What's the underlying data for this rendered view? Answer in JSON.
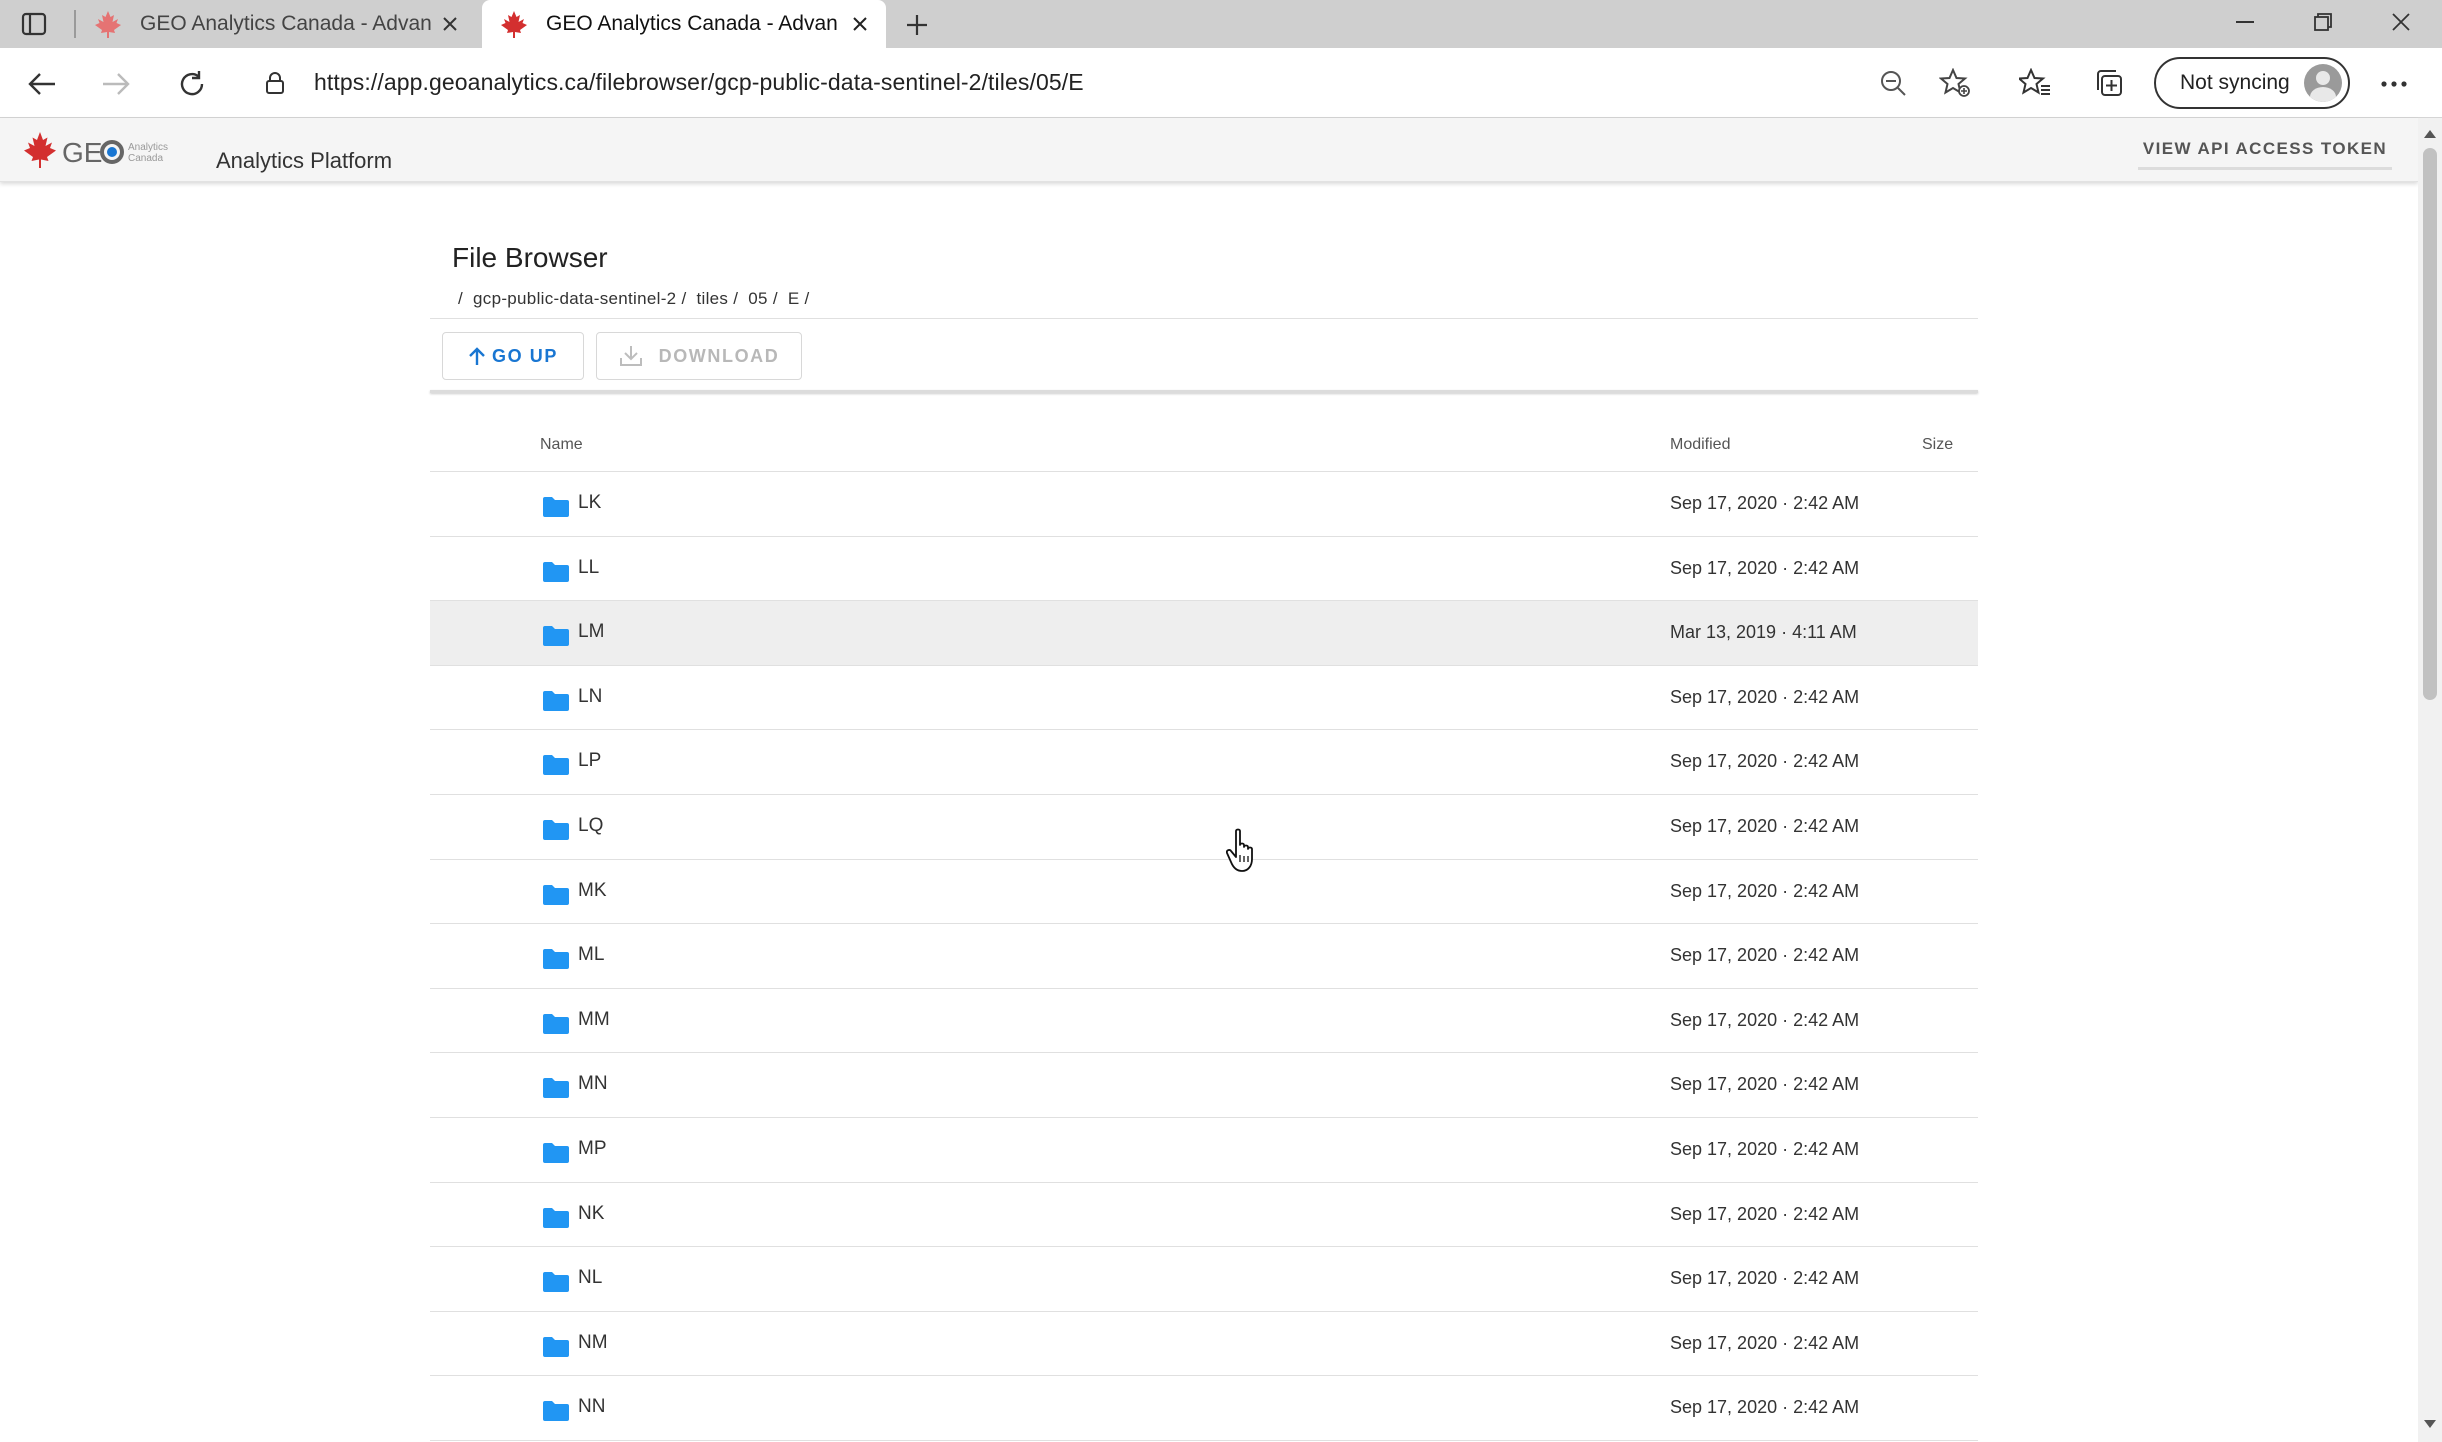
{
  "browser": {
    "tabs": [
      {
        "title": "GEO Analytics Canada - Advancing",
        "active": false
      },
      {
        "title": "GEO Analytics Canada - Advancing",
        "active": true
      }
    ],
    "url": "https://app.geoanalytics.ca/filebrowser/gcp-public-data-sentinel-2/tiles/05/E",
    "profile_label": "Not syncing",
    "icons": {
      "sidebar": "tab-actions-icon",
      "new_tab": "plus-icon",
      "back": "back-arrow-icon",
      "forward": "forward-arrow-icon",
      "refresh": "refresh-icon",
      "lock": "lock-icon",
      "zoom": "zoom-out-icon",
      "favorite": "add-favorite-icon",
      "favorites": "favorites-icon",
      "collections": "collections-icon",
      "more": "more-dots-icon"
    }
  },
  "app": {
    "logo_text": "GEO",
    "logo_sub": "Analytics Canada",
    "title": "Analytics Platform",
    "api_token_label": "VIEW API ACCESS TOKEN",
    "accent_color": "#1976d2",
    "folder_color": "#2196f3"
  },
  "file_browser": {
    "title": "File Browser",
    "breadcrumb": [
      "/",
      "gcp-public-data-sentinel-2 /",
      "tiles /",
      "05 /",
      "E /"
    ],
    "go_up_label": "GO UP",
    "download_label": "DOWNLOAD",
    "columns": {
      "name": "Name",
      "modified": "Modified",
      "size": "Size"
    },
    "rows": [
      {
        "name": "LK",
        "modified": "Sep 17, 2020 · 2:42 AM",
        "size": ""
      },
      {
        "name": "LL",
        "modified": "Sep 17, 2020 · 2:42 AM",
        "size": ""
      },
      {
        "name": "LM",
        "modified": "Mar 13, 2019 · 4:11 AM",
        "size": ""
      },
      {
        "name": "LN",
        "modified": "Sep 17, 2020 · 2:42 AM",
        "size": ""
      },
      {
        "name": "LP",
        "modified": "Sep 17, 2020 · 2:42 AM",
        "size": ""
      },
      {
        "name": "LQ",
        "modified": "Sep 17, 2020 · 2:42 AM",
        "size": ""
      },
      {
        "name": "MK",
        "modified": "Sep 17, 2020 · 2:42 AM",
        "size": ""
      },
      {
        "name": "ML",
        "modified": "Sep 17, 2020 · 2:42 AM",
        "size": ""
      },
      {
        "name": "MM",
        "modified": "Sep 17, 2020 · 2:42 AM",
        "size": ""
      },
      {
        "name": "MN",
        "modified": "Sep 17, 2020 · 2:42 AM",
        "size": ""
      },
      {
        "name": "MP",
        "modified": "Sep 17, 2020 · 2:42 AM",
        "size": ""
      },
      {
        "name": "NK",
        "modified": "Sep 17, 2020 · 2:42 AM",
        "size": ""
      },
      {
        "name": "NL",
        "modified": "Sep 17, 2020 · 2:42 AM",
        "size": ""
      },
      {
        "name": "NM",
        "modified": "Sep 17, 2020 · 2:42 AM",
        "size": ""
      },
      {
        "name": "NN",
        "modified": "Sep 17, 2020 · 2:42 AM",
        "size": ""
      }
    ],
    "hovered_row": 2
  }
}
